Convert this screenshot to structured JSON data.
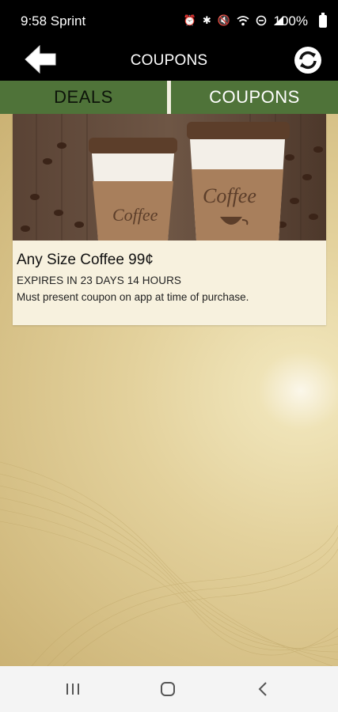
{
  "status_bar": {
    "time_carrier": "9:58 Sprint",
    "battery": "100%",
    "icons": [
      "alarm-icon",
      "bluetooth-icon",
      "mute-icon",
      "wifi-icon",
      "data-sync-icon",
      "signal-icon",
      "battery-icon"
    ]
  },
  "header": {
    "title": "COUPONS"
  },
  "tabs": [
    {
      "label": "DEALS",
      "selected": false
    },
    {
      "label": "COUPONS",
      "selected": true
    }
  ],
  "coupon": {
    "image_cup_text_left": "Coffee",
    "image_cup_text_right": "Coffee",
    "title": "Any Size Coffee 99¢",
    "expiry": "EXPIRES IN 23 DAYS 14 HOURS",
    "description": "Must present coupon on app at time of purchase."
  },
  "colors": {
    "tab_green": "#4f7339",
    "background_gold": "#e3d19c",
    "card_bg": "#f7f1de"
  }
}
